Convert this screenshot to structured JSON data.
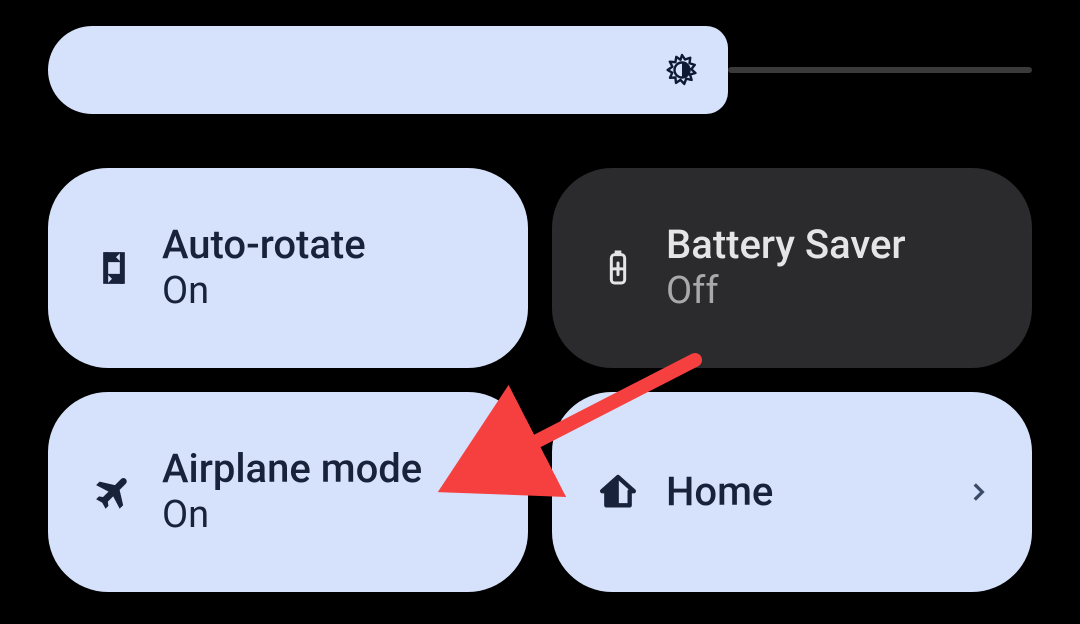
{
  "brightness": {
    "percent": 69,
    "icon_name": "brightness-medium-icon"
  },
  "tiles": [
    {
      "title": "Auto-rotate",
      "status": "On",
      "state": "on",
      "icon_name": "auto-rotate-icon",
      "has_chevron": false
    },
    {
      "title": "Battery Saver",
      "status": "Off",
      "state": "off",
      "icon_name": "battery-saver-icon",
      "has_chevron": false
    },
    {
      "title": "Airplane mode",
      "status": "On",
      "state": "on",
      "icon_name": "airplane-icon",
      "has_chevron": false
    },
    {
      "title": "Home",
      "status": "",
      "state": "on",
      "icon_name": "home-icon",
      "has_chevron": true
    }
  ],
  "colors": {
    "tile_on_bg": "#D6E2FB",
    "tile_off_bg": "#2B2B2D",
    "text_dark": "#18233B",
    "text_light": "#E5E5E7",
    "arrow": "#F6403F"
  },
  "annotation": {
    "arrow_points_to": "tile-airplane-mode"
  }
}
